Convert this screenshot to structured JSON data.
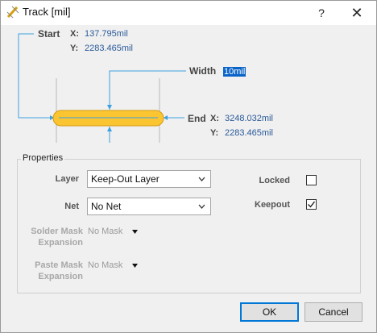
{
  "window": {
    "title": "Track [mil]",
    "help_label": "?",
    "close_label": "✕"
  },
  "diagram": {
    "start": {
      "label": "Start",
      "x_key": "X:",
      "x_value": "137.795mil",
      "y_key": "Y:",
      "y_value": "2283.465mil"
    },
    "end": {
      "label": "End",
      "x_key": "X:",
      "x_value": "3248.032mil",
      "y_key": "Y:",
      "y_value": "2283.465mil"
    },
    "width": {
      "label": "Width",
      "value": "10mil"
    },
    "track_color": "#fbc531",
    "leader_color": "#3ca0e0"
  },
  "properties": {
    "legend": "Properties",
    "layer": {
      "label": "Layer",
      "value": "Keep-Out Layer"
    },
    "net": {
      "label": "Net",
      "value": "No Net"
    },
    "solder_mask": {
      "label_line1": "Solder Mask",
      "label_line2": "Expansion",
      "value": "No Mask"
    },
    "paste_mask": {
      "label_line1": "Paste Mask",
      "label_line2": "Expansion",
      "value": "No Mask"
    },
    "locked": {
      "label": "Locked",
      "checked": false
    },
    "keepout": {
      "label": "Keepout",
      "checked": true
    }
  },
  "buttons": {
    "ok": "OK",
    "cancel": "Cancel"
  }
}
